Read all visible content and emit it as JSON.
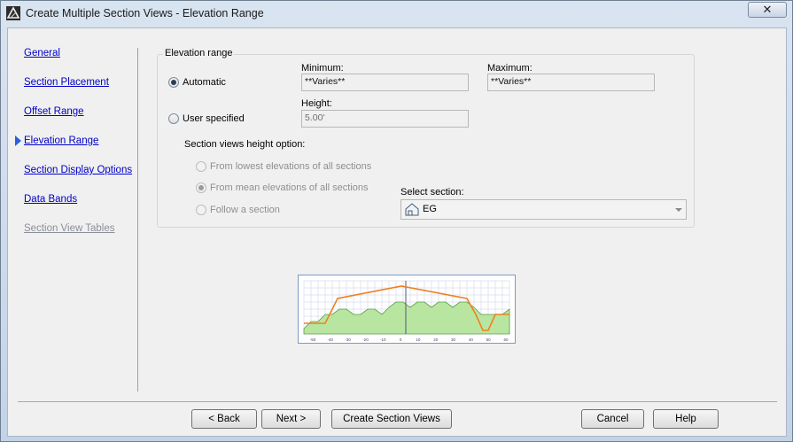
{
  "window": {
    "title": "Create Multiple Section Views - Elevation Range",
    "close_glyph": "✕"
  },
  "nav": {
    "items": [
      {
        "label": "General",
        "state": "normal"
      },
      {
        "label": "Section Placement",
        "state": "normal"
      },
      {
        "label": "Offset Range",
        "state": "normal"
      },
      {
        "label": "Elevation Range",
        "state": "current"
      },
      {
        "label": "Section Display Options",
        "state": "normal"
      },
      {
        "label": "Data Bands",
        "state": "normal"
      },
      {
        "label": "Section View Tables",
        "state": "disabled"
      }
    ]
  },
  "elevation": {
    "group_label": "Elevation range",
    "automatic_label": "Automatic",
    "automatic_selected": true,
    "user_specified_label": "User specified",
    "minimum_label": "Minimum:",
    "minimum_value": "**Varies**",
    "maximum_label": "Maximum:",
    "maximum_value": "**Varies**",
    "height_label": "Height:",
    "height_value": "5.00'",
    "height_option_label": "Section views height option:",
    "options": [
      {
        "label": "From lowest elevations of all sections",
        "checked": false
      },
      {
        "label": "From mean elevations of all sections",
        "checked": true
      },
      {
        "label": "Follow a section",
        "checked": false
      }
    ],
    "select_section_label": "Select section:",
    "select_section_value": "EG"
  },
  "preview": {
    "x_ticks": [
      "-50",
      "-40",
      "-30",
      "-20",
      "-10",
      "0",
      "10",
      "20",
      "30",
      "40",
      "50",
      "60"
    ],
    "accent_color": "#f08020",
    "ground_color": "#b8e6a0"
  },
  "footer": {
    "back": "< Back",
    "next": "Next >",
    "create": "Create Section Views",
    "cancel": "Cancel",
    "help": "Help"
  }
}
